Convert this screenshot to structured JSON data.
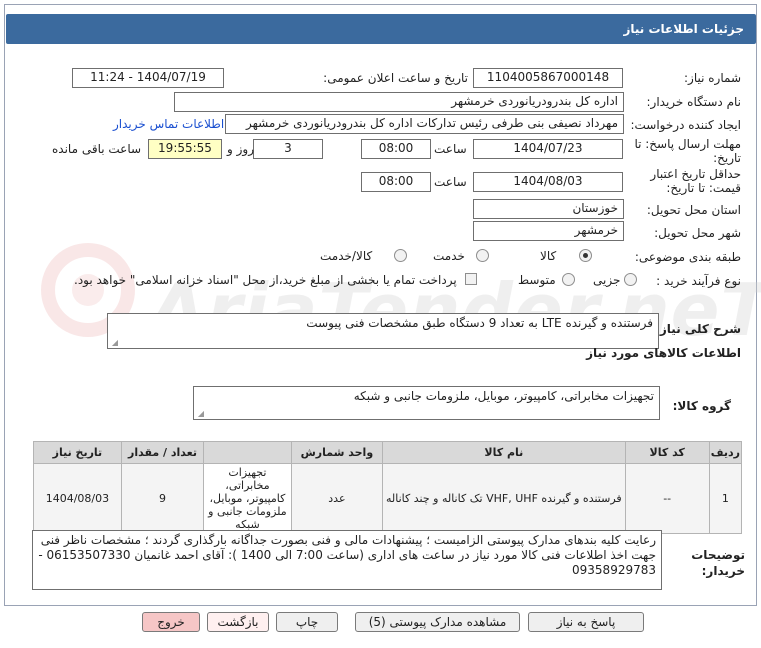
{
  "title": "جزئیات اطلاعات نیاز",
  "need_number": {
    "label": "شماره نیاز:",
    "value": "1104005867000148"
  },
  "announce_datetime": {
    "label": "تاریخ و ساعت اعلان عمومی:",
    "value": "1404/07/19 - 11:24"
  },
  "buyer_org": {
    "label": "نام دستگاه خریدار:",
    "value": "اداره کل بندرودریانوردی خرمشهر"
  },
  "requester": {
    "label": "ایجاد کننده درخواست:",
    "value": "مهرداد  نصیفی بنی طرفی رئیس تدارکات اداره کل بندرودریانوردی خرمشهر",
    "contact_link": "اطلاعات تماس خریدار"
  },
  "reply_deadline": {
    "label": "مهلت ارسال پاسخ: تا تاریخ:",
    "date": "1404/07/23",
    "time_label": "ساعت",
    "time": "08:00",
    "days": "3",
    "days_label": "روز و",
    "remaining": "19:55:55",
    "remaining_label": "ساعت باقی مانده"
  },
  "price_validity": {
    "label": "حداقل تاریخ اعتبار قیمت: تا تاریخ:",
    "date": "1404/08/03",
    "time_label": "ساعت",
    "time": "08:00"
  },
  "delivery_province": {
    "label": "استان محل تحویل:",
    "value": "خوزستان"
  },
  "delivery_city": {
    "label": "شهر محل تحویل:",
    "value": "خرمشهر"
  },
  "category": {
    "label": "طبقه بندی موضوعی:",
    "options": [
      "کالا",
      "خدمت",
      "کالا/خدمت"
    ],
    "selected": "کالا"
  },
  "process_type": {
    "label": "نوع فرآیند خرید :",
    "options": [
      "جزیی",
      "متوسط"
    ],
    "payment_note": "پرداخت تمام یا بخشی از مبلغ خرید،از محل \"اسناد خزانه اسلامی\" خواهد بود."
  },
  "general_desc": {
    "label": "شرح کلی نیاز:",
    "value": "فرستنده و گیرنده LTE  به تعداد 9 دستگاه طبق مشخصات فنی پیوست"
  },
  "goods_info_title": "اطلاعات کالاهای مورد نیاز",
  "goods_group": {
    "label": "گروه کالا:",
    "value": "تجهیزات مخابراتی، کامپیوتر، موبایل، ملزومات جانبی و شبکه"
  },
  "watermark": "AriaTender.neT",
  "table": {
    "headers": [
      "ردیف",
      "کد کالا",
      "نام کالا",
      "واحد شمارش",
      "تعداد / مقدار",
      "تاریخ نیاز"
    ],
    "rows": [
      {
        "row": "1",
        "code": "--",
        "name": "فرستنده و گیرنده VHF, UHF تک کاناله و چند کاناله",
        "unit": "عدد",
        "qty": "9",
        "date": "1404/08/03",
        "group_note": "تجهیزات مخابراتی، کامپیوتر، موبایل، ملزومات جانبی و شبکه"
      }
    ]
  },
  "buyer_notes": {
    "label": "توضیحات خریدار:",
    "value": "رعایت کلیه بندهای مدارک پیوستی الزامیست ؛ پیشنهادات مالی و فنی بصورت جداگانه بارگذاری گردند ؛ مشخصات ناظر فنی جهت اخذ اطلاعات فنی کالا مورد نیاز در ساعت های اداری (ساعت 7:00 الی 1400 ): آقای احمد غانمیان   06153507330  - 09358929783"
  },
  "buttons": {
    "reply": "پاسخ به نیاز",
    "attachments": "مشاهده مدارک پیوستی (5)",
    "print": "چاپ",
    "back": "بازگشت",
    "exit": "خروج"
  }
}
